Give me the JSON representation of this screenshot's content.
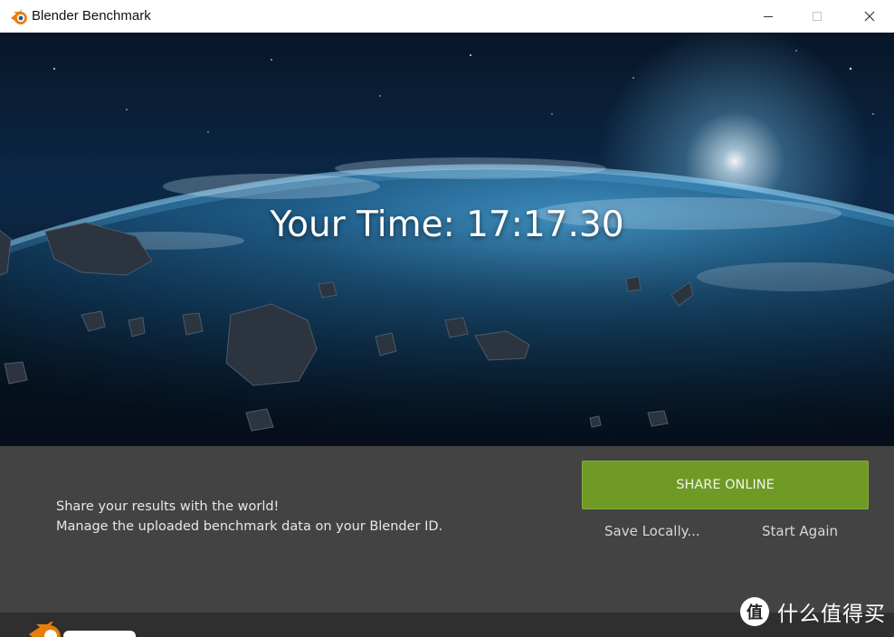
{
  "window": {
    "title": "Blender Benchmark",
    "controls": [
      "minimize",
      "maximize",
      "close"
    ]
  },
  "hero": {
    "result_text": "Your Time: 17:17.30",
    "background": "earth-from-space-with-asteroids"
  },
  "panel": {
    "message_line1": "Share your results with the world!",
    "message_line2": "Manage the uploaded benchmark data on your Blender ID.",
    "share_button": "SHARE ONLINE",
    "save_button": "Save Locally...",
    "restart_button": "Start Again"
  },
  "watermark": {
    "badge": "值",
    "text": "什么值得买"
  },
  "colors": {
    "share_button": "#6e9a25",
    "panel_bg": "#434343",
    "footer_bg": "#2f2f2f",
    "blender_orange": "#e87d0d"
  },
  "icons": {
    "app": "blender-logo-icon",
    "minimize": "minimize-icon",
    "maximize": "maximize-icon",
    "close": "close-icon"
  }
}
